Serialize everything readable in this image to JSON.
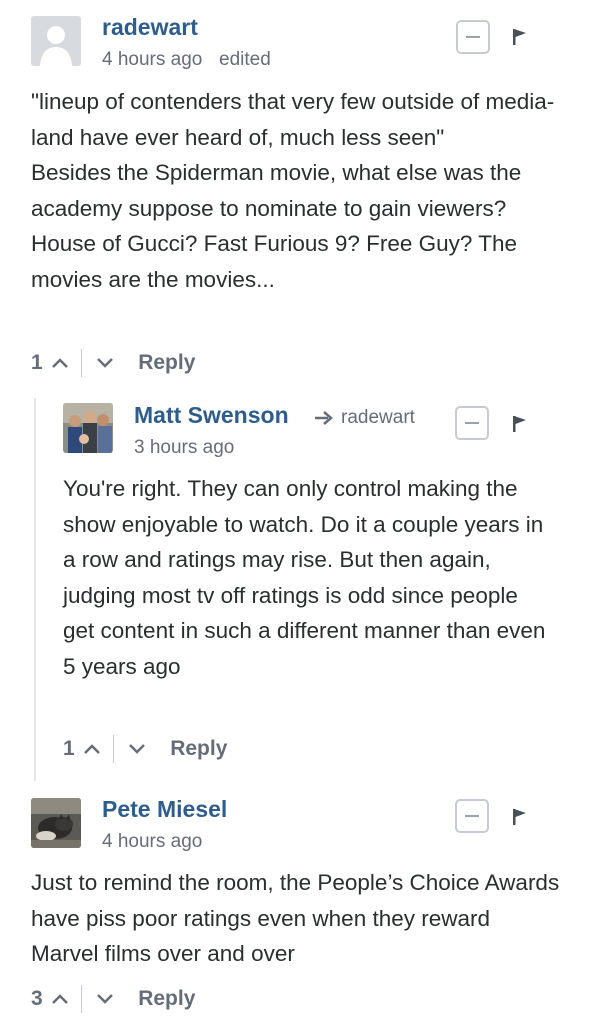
{
  "comments": [
    {
      "author": "radewart",
      "time": "4 hours ago",
      "edited": "edited",
      "body": [
        "\"lineup of contenders that very few outside of media-land have ever heard of, much less seen\"",
        "Besides the Spiderman movie, what else was the academy suppose to nominate to gain viewers? House of Gucci? Fast Furious 9? Free Guy? The movies are the movies..."
      ],
      "votes": "1",
      "reply_label": "Reply",
      "avatar": "default-avatar-icon"
    },
    {
      "author": "Matt Swenson",
      "reply_to": "radewart",
      "time": "3 hours ago",
      "body": [
        "You're right. They can only control making the show enjoyable to watch. Do it a couple years in a row and ratings may rise. But then again, judging most tv off ratings is odd since people get content in such a different manner than even 5 years ago"
      ],
      "votes": "1",
      "reply_label": "Reply",
      "avatar": "family-photo-avatar"
    },
    {
      "author": "Pete Miesel",
      "time": "4 hours ago",
      "body": [
        "Just to remind the room, the People’s Choice Awards have piss poor ratings even when they reward Marvel films over and over"
      ],
      "votes": "3",
      "reply_label": "Reply",
      "avatar": "cat-photo-avatar"
    }
  ],
  "colors": {
    "author": "#2e5d8c",
    "meta": "#656c7a",
    "text": "#2a2e2e",
    "border": "#c7cbd1"
  }
}
